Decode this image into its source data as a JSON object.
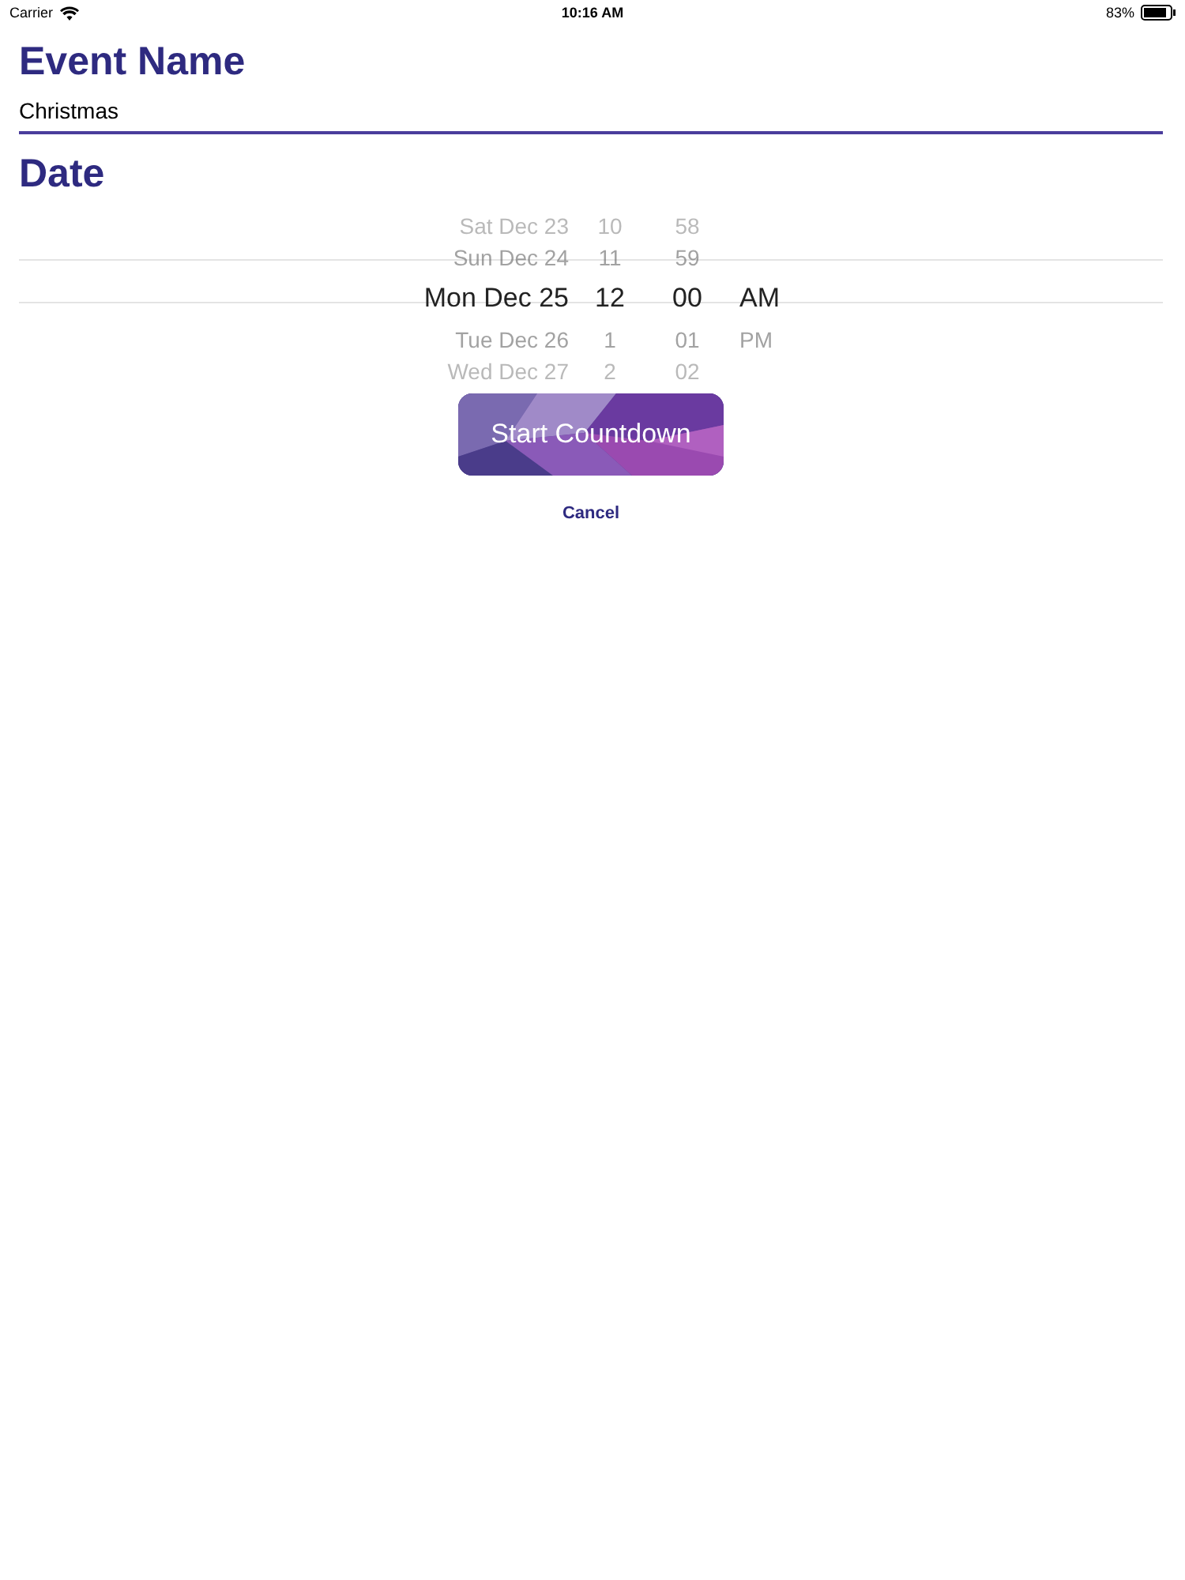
{
  "status_bar": {
    "carrier": "Carrier",
    "time": "10:16 AM",
    "battery": "83%"
  },
  "event_name": {
    "heading": "Event Name",
    "value": "Christmas"
  },
  "date": {
    "heading": "Date",
    "picker_rows": [
      {
        "date": "Sat Dec 23",
        "hour": "10",
        "minute": "58",
        "selected": false
      },
      {
        "date": "Sun Dec 24",
        "hour": "11",
        "minute": "59",
        "selected": false
      },
      {
        "date": "Mon Dec 25",
        "hour": "12",
        "minute": "00",
        "period": "AM",
        "selected": true
      },
      {
        "date": "Tue Dec 26",
        "hour": "1",
        "minute": "01",
        "period": "PM",
        "selected": false
      },
      {
        "date": "Wed Dec 27",
        "hour": "2",
        "minute": "02",
        "selected": false
      }
    ]
  },
  "buttons": {
    "start": "Start Countdown",
    "cancel": "Cancel"
  }
}
